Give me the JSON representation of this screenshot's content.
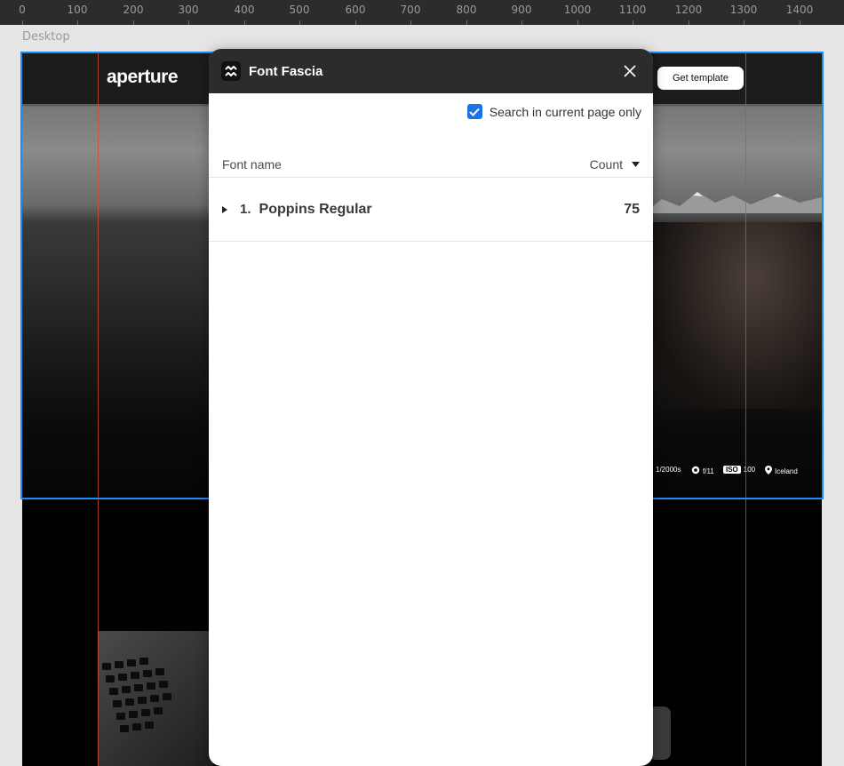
{
  "ruler": {
    "ticks": [
      "0",
      "100",
      "200",
      "300",
      "400",
      "500",
      "600",
      "700",
      "800",
      "900",
      "1000",
      "1100",
      "1200",
      "1300",
      "1400"
    ]
  },
  "canvas": {
    "frame_label": "Desktop"
  },
  "site": {
    "logo": "aperture",
    "cta_label": "Get template",
    "meta": {
      "shutter": "1/2000s",
      "aperture": "f/11",
      "iso_badge": "ISO",
      "iso_value": "100",
      "location": "Iceland"
    }
  },
  "plugin": {
    "title": "Font Fascia",
    "search_option_label": "Search in current page only",
    "search_option_checked": true,
    "columns": {
      "name": "Font name",
      "count": "Count"
    },
    "fonts": [
      {
        "index": "1.",
        "name": "Poppins Regular",
        "count": "75"
      }
    ]
  },
  "colors": {
    "accent": "#1a73e8",
    "selection": "#1e8cf2",
    "guide": "#e14632",
    "header_bg": "#2c2c2c"
  }
}
